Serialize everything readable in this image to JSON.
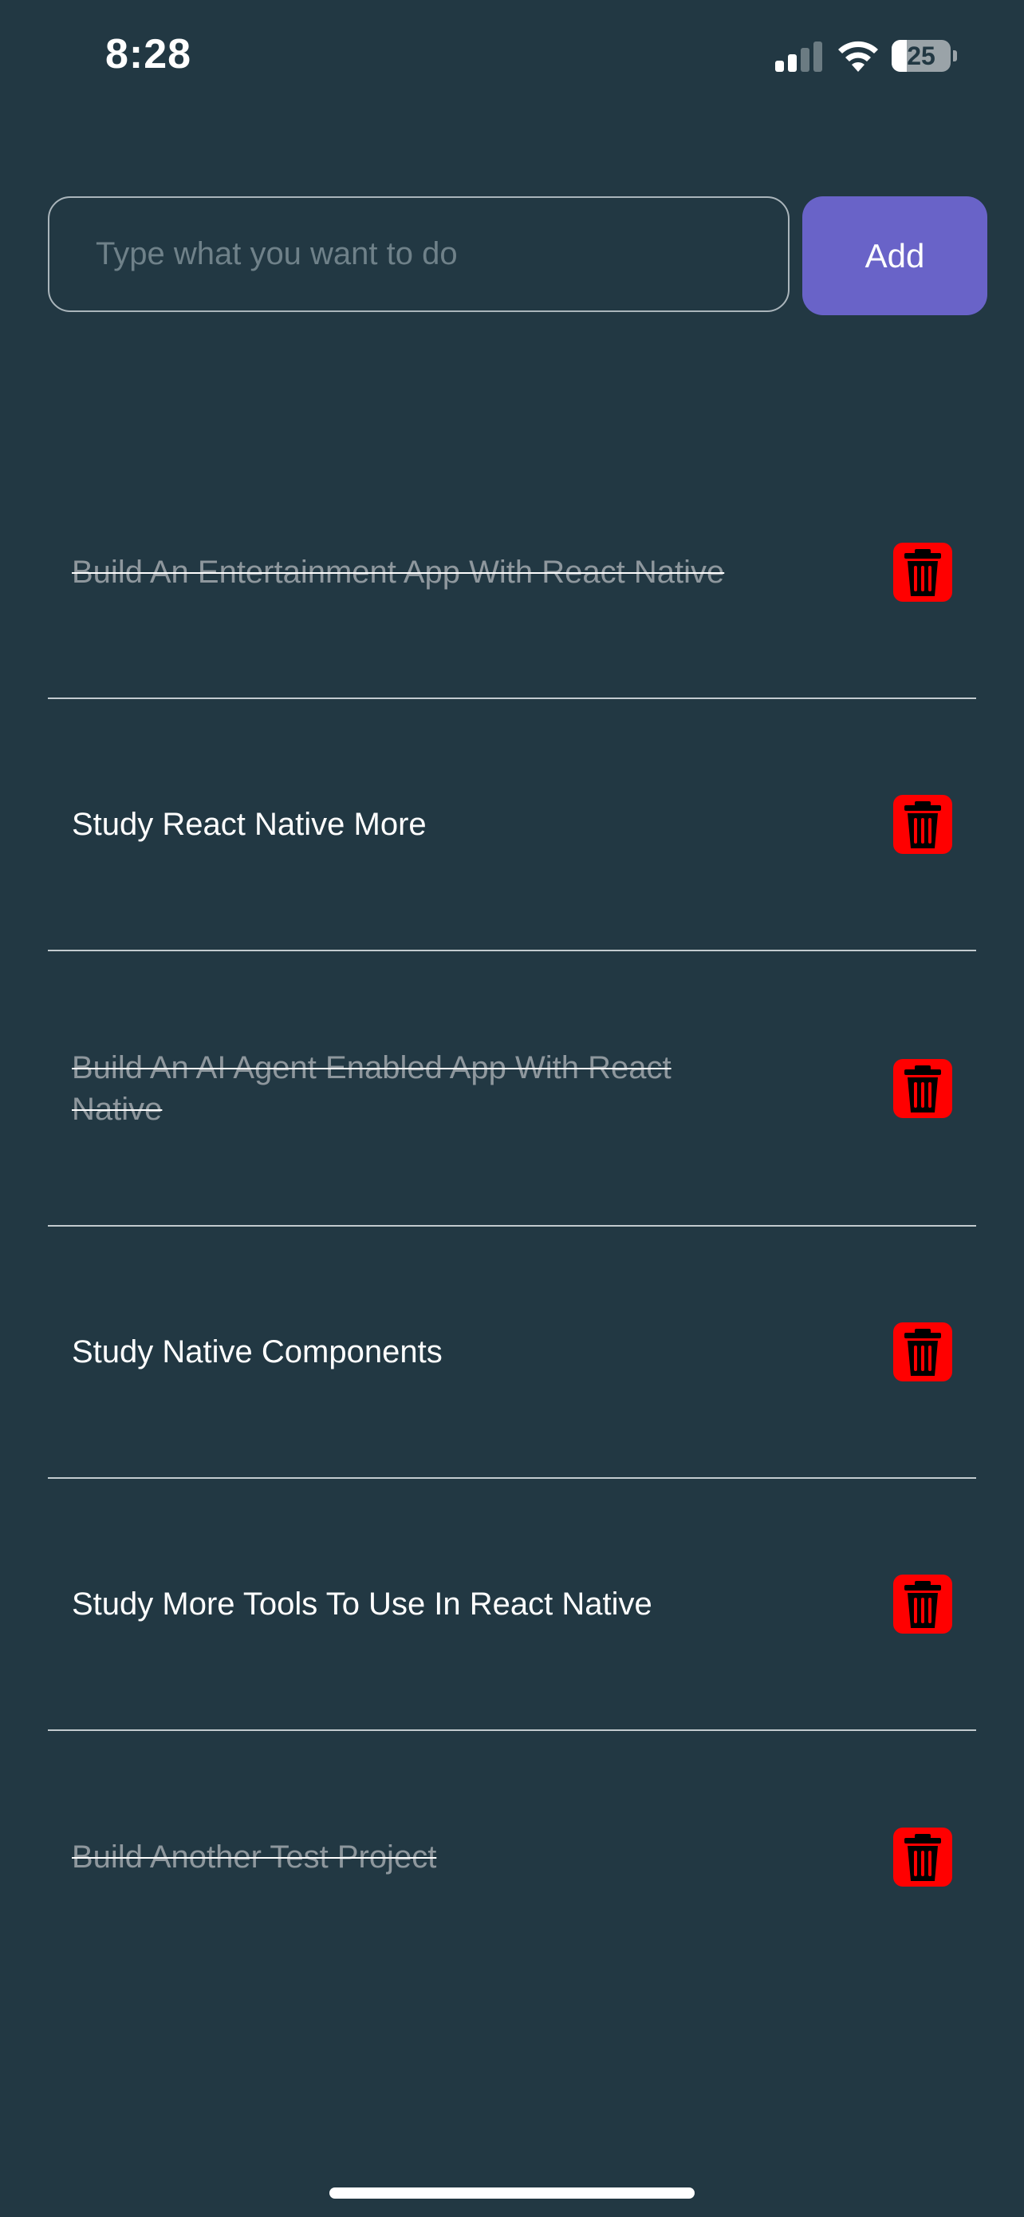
{
  "status_bar": {
    "time": "8:28",
    "battery_level": "25",
    "battery_fraction": 0.25
  },
  "input": {
    "placeholder": "Type what you want to do",
    "value": ""
  },
  "add_button_label": "Add",
  "colors": {
    "background": "#223843",
    "accent": "#6963c8",
    "delete": "#ff0000",
    "done_text": "#8e979d"
  },
  "tasks": [
    {
      "text": "Build An Entertainment App With React Native",
      "done": true,
      "icon": "trash-icon"
    },
    {
      "text": "Study React Native More",
      "done": false,
      "icon": "trash-icon"
    },
    {
      "text": "Build An AI Agent Enabled App With React Native",
      "done": true,
      "icon": "trash-icon"
    },
    {
      "text": "Study Native Components",
      "done": false,
      "icon": "trash-icon"
    },
    {
      "text": "Study More Tools To Use In React Native",
      "done": false,
      "icon": "trash-icon"
    },
    {
      "text": "Build Another Test Project",
      "done": true,
      "icon": "trash-icon"
    }
  ]
}
